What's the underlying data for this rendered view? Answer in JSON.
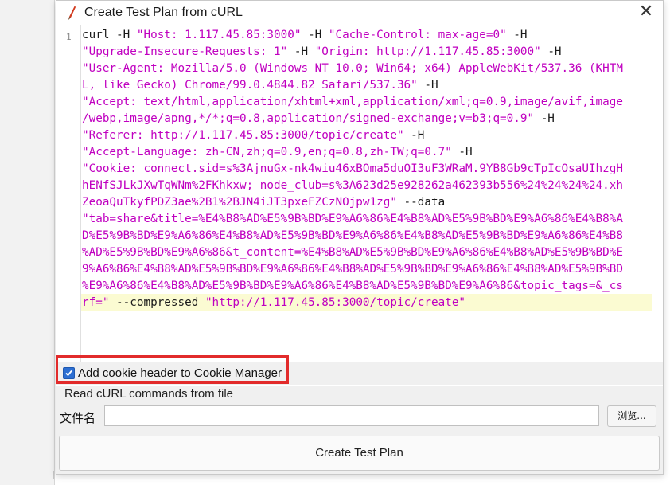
{
  "dialog": {
    "title": "Create Test Plan from cURL",
    "close_glyph": "✕",
    "title_icon": "feather-pen-icon"
  },
  "editor": {
    "line_number": "1",
    "lines": [
      [
        [
          "plain",
          "curl -H "
        ],
        [
          "str",
          "\"Host: 1.117.45.85:3000\""
        ],
        [
          "plain",
          " -H "
        ],
        [
          "str",
          "\"Cache-Control: max-age=0\""
        ],
        [
          "plain",
          " -H"
        ]
      ],
      [
        [
          "str",
          "\"Upgrade-Insecure-Requests: 1\""
        ],
        [
          "plain",
          " -H "
        ],
        [
          "str",
          "\"Origin: http://1.117.45.85:3000\""
        ],
        [
          "plain",
          " -H"
        ]
      ],
      [
        [
          "str",
          "\"User-Agent: Mozilla/5.0 (Windows NT 10.0; Win64; x64) AppleWebKit/537.36 (KHTM"
        ]
      ],
      [
        [
          "str",
          "L, like Gecko) Chrome/99.0.4844.82 Safari/537.36\""
        ],
        [
          "plain",
          " -H"
        ]
      ],
      [
        [
          "str",
          "\"Accept: text/html,application/xhtml+xml,application/xml;q=0.9,image/avif,image"
        ]
      ],
      [
        [
          "str",
          "/webp,image/apng,*/*;q=0.8,application/signed-exchange;v=b3;q=0.9\""
        ],
        [
          "plain",
          " -H"
        ]
      ],
      [
        [
          "str",
          "\"Referer: http://1.117.45.85:3000/topic/create\""
        ],
        [
          "plain",
          " -H"
        ]
      ],
      [
        [
          "str",
          "\"Accept-Language: zh-CN,zh;q=0.9,en;q=0.8,zh-TW;q=0.7\""
        ],
        [
          "plain",
          " -H"
        ]
      ],
      [
        [
          "str",
          "\"Cookie: connect.sid=s%3AjnuGx-nk4wiu46xBOma5duOI3uF3WRaM.9YB8Gb9cTpIcOsaUIhzgH"
        ]
      ],
      [
        [
          "str",
          "hENfSJLkJXwTqWNm%2FKhkxw; node_club=s%3A623d25e928262a462393b556%24%24%24%24.xh"
        ]
      ],
      [
        [
          "str",
          "ZeoaQuTkyfPDZ3ae%2B1%2BJN4iJT3pxeFZCzNOjpw1zg\""
        ],
        [
          "plain",
          " --data"
        ]
      ],
      [
        [
          "str",
          "\"tab=share&title=%E4%B8%AD%E5%9B%BD%E9%A6%86%E4%B8%AD%E5%9B%BD%E9%A6%86%E4%B8%A"
        ]
      ],
      [
        [
          "str",
          "D%E5%9B%BD%E9%A6%86%E4%B8%AD%E5%9B%BD%E9%A6%86%E4%B8%AD%E5%9B%BD%E9%A6%86%E4%B8"
        ]
      ],
      [
        [
          "str",
          "%AD%E5%9B%BD%E9%A6%86&t_content=%E4%B8%AD%E5%9B%BD%E9%A6%86%E4%B8%AD%E5%9B%BD%E"
        ]
      ],
      [
        [
          "str",
          "9%A6%86%E4%B8%AD%E5%9B%BD%E9%A6%86%E4%B8%AD%E5%9B%BD%E9%A6%86%E4%B8%AD%E5%9B%BD"
        ]
      ],
      [
        [
          "str",
          "%E9%A6%86%E4%B8%AD%E5%9B%BD%E9%A6%86%E4%B8%AD%E5%9B%BD%E9%A6%86&topic_tags=&_cs"
        ]
      ],
      [
        [
          "str",
          "rf=\""
        ],
        [
          "plain",
          " --compressed "
        ],
        [
          "str",
          "\"http://1.117.45.85:3000/topic/create\""
        ]
      ]
    ]
  },
  "options": {
    "cookie_checkbox_label": "Add cookie header to Cookie Manager",
    "cookie_checkbox_checked": true
  },
  "file_section": {
    "title": "Read cURL commands from file",
    "file_label": "文件名",
    "file_value": "",
    "browse_label": "浏览..."
  },
  "actions": {
    "create_label": "Create Test Plan"
  },
  "colors": {
    "string": "#c000c0",
    "highlight_border": "#e22b2b",
    "checkbox": "#2d6fd2"
  }
}
